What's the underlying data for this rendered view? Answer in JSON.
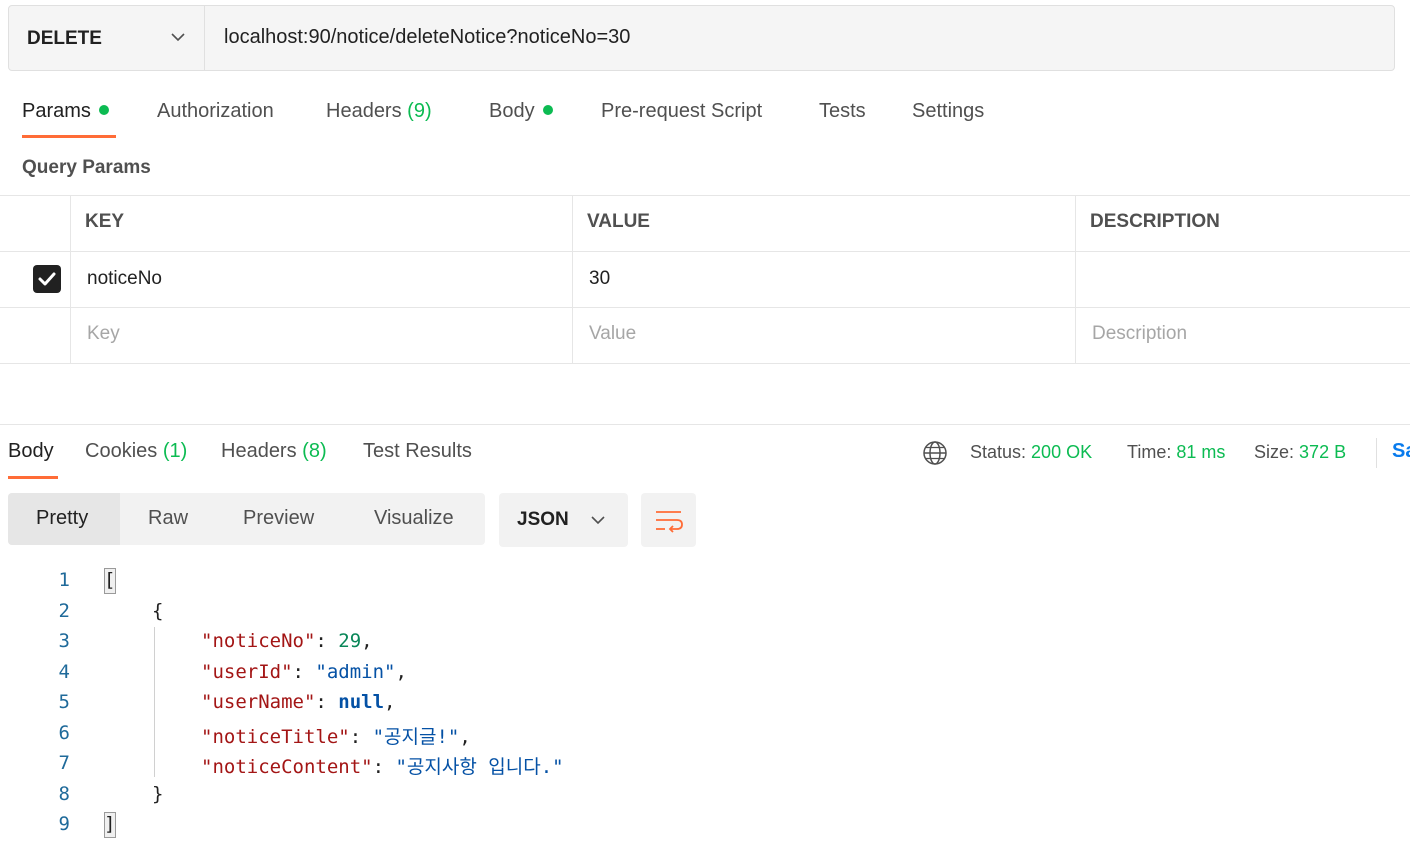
{
  "request": {
    "method": "DELETE",
    "url": "localhost:90/notice/deleteNotice?noticeNo=30",
    "tabs": {
      "params": "Params",
      "authorization": "Authorization",
      "headers": "Headers",
      "headers_count": "(9)",
      "body": "Body",
      "prerequest": "Pre-request Script",
      "tests": "Tests",
      "settings": "Settings"
    }
  },
  "query_params": {
    "title": "Query Params",
    "columns": {
      "key": "KEY",
      "value": "VALUE",
      "description": "DESCRIPTION"
    },
    "rows": [
      {
        "checked": true,
        "key": "noticeNo",
        "value": "30",
        "description": ""
      }
    ],
    "placeholders": {
      "key": "Key",
      "value": "Value",
      "description": "Description"
    }
  },
  "response": {
    "tabs": {
      "body": "Body",
      "cookies": "Cookies",
      "cookies_count": "(1)",
      "headers": "Headers",
      "headers_count": "(8)",
      "test_results": "Test Results"
    },
    "status_label": "Status:",
    "status_value": "200 OK",
    "time_label": "Time:",
    "time_value": "81 ms",
    "size_label": "Size:",
    "size_value": "372 B",
    "save_partial": "Sa",
    "view_modes": {
      "pretty": "Pretty",
      "raw": "Raw",
      "preview": "Preview",
      "visualize": "Visualize"
    },
    "format": "JSON",
    "line_numbers": [
      "1",
      "2",
      "3",
      "4",
      "5",
      "6",
      "7",
      "8",
      "9"
    ],
    "code": {
      "open_array": "[",
      "open_obj": "{",
      "k_noticeNo": "\"noticeNo\"",
      "v_noticeNo": "29",
      "k_userId": "\"userId\"",
      "v_userId": "\"admin\"",
      "k_userName": "\"userName\"",
      "v_userName": "null",
      "k_noticeTitle": "\"noticeTitle\"",
      "v_noticeTitle": "\"공지글!\"",
      "k_noticeContent": "\"noticeContent\"",
      "v_noticeContent": "\"공지사항 입니다.\"",
      "close_obj": "}",
      "close_array": "]"
    }
  },
  "colors": {
    "accent": "#ff6c37",
    "success": "#0cbb52",
    "link": "#097bed"
  },
  "icons": [
    "chevron-down-icon",
    "globe-icon",
    "wrap-lines-icon",
    "checkbox-checked-icon"
  ]
}
